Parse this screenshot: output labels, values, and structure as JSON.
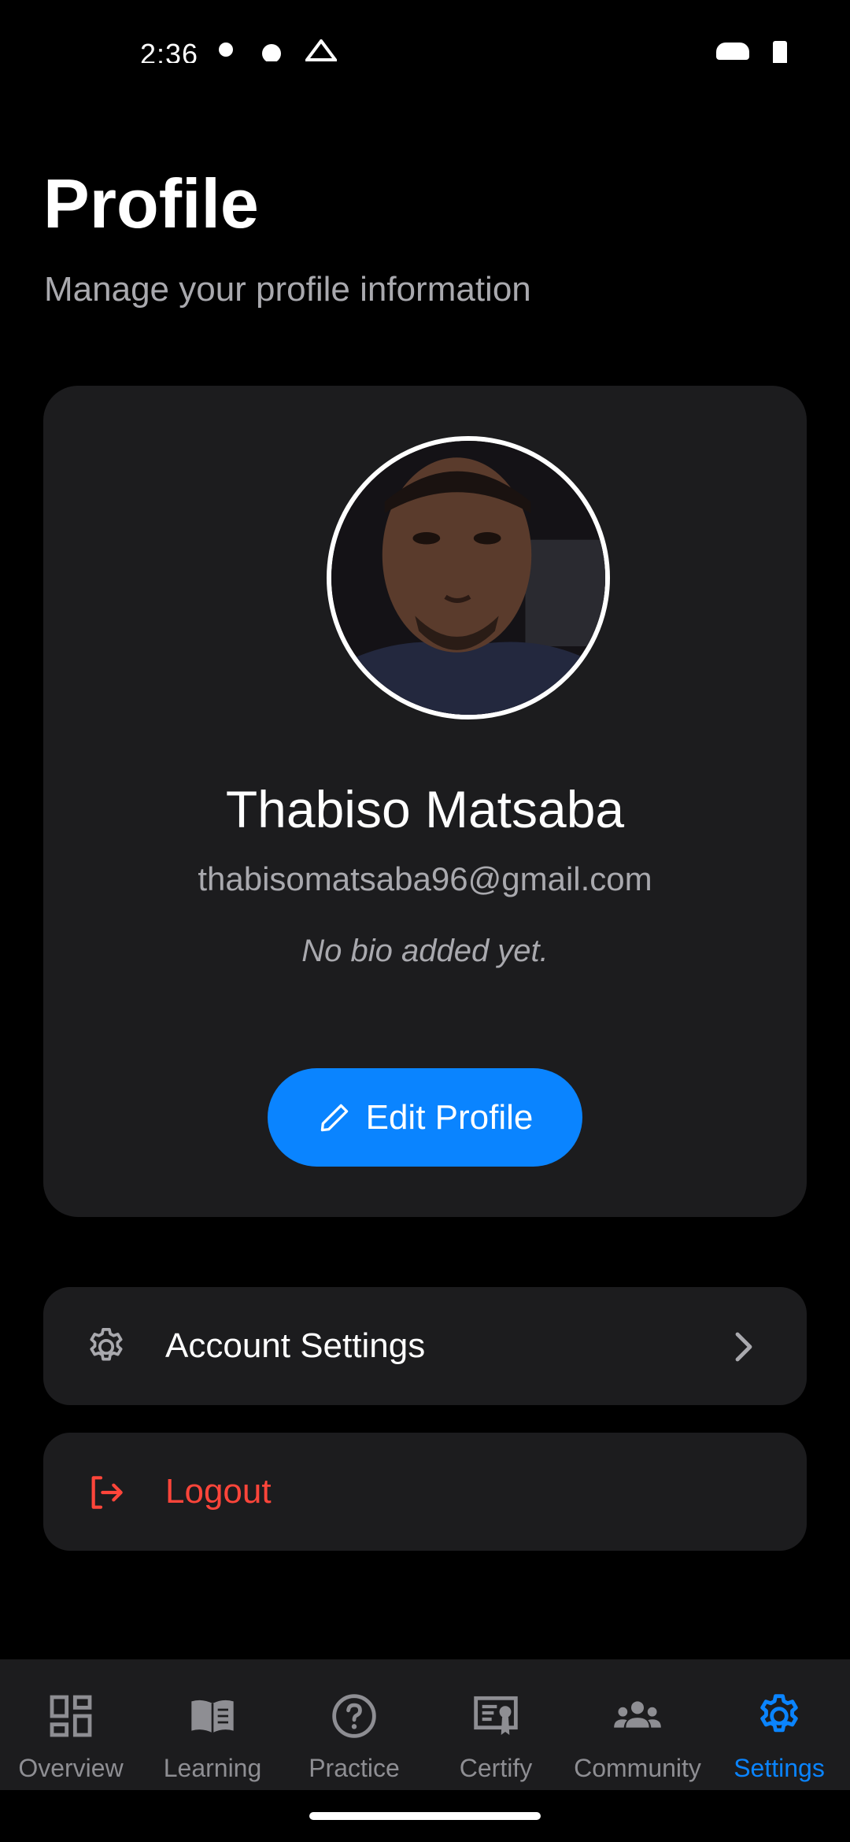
{
  "status_bar": {
    "time": "2:36"
  },
  "header": {
    "title": "Profile",
    "subtitle": "Manage your profile information"
  },
  "profile": {
    "name": "Thabiso Matsaba",
    "email": "thabisomatsaba96@gmail.com",
    "bio": "No bio added yet.",
    "edit_button_label": "Edit Profile",
    "edit_icon": "pencil-icon"
  },
  "menu": {
    "account_settings": {
      "label": "Account Settings",
      "icon": "gear-icon"
    },
    "logout": {
      "label": "Logout",
      "icon": "logout-icon"
    }
  },
  "tab_bar": {
    "tabs": [
      {
        "label": "Overview",
        "icon": "dashboard-icon",
        "active": false
      },
      {
        "label": "Learning",
        "icon": "book-icon",
        "active": false
      },
      {
        "label": "Practice",
        "icon": "help-circle-icon",
        "active": false
      },
      {
        "label": "Certify",
        "icon": "certificate-icon",
        "active": false
      },
      {
        "label": "Community",
        "icon": "people-icon",
        "active": false
      },
      {
        "label": "Settings",
        "icon": "gear-icon",
        "active": true
      }
    ]
  },
  "colors": {
    "background": "#000000",
    "card": "#1c1c1e",
    "accent": "#0a84ff",
    "danger": "#ff453a",
    "muted_text": "#a9a9ae",
    "inactive_tab": "#8e8e93"
  }
}
